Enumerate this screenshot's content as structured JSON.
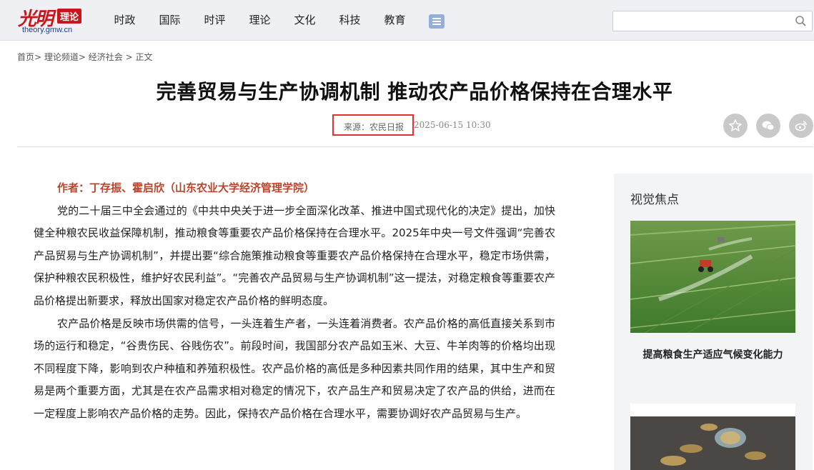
{
  "site": {
    "logo_script": "光明",
    "logo_badge": "理论",
    "logo_url": "theory.gmw.cn"
  },
  "nav": {
    "items": [
      "时政",
      "国际",
      "时评",
      "理论",
      "文化",
      "科技",
      "教育"
    ]
  },
  "search": {
    "placeholder": ""
  },
  "breadcrumb": {
    "home": "首页",
    "sep1": "> ",
    "channel": "理论频道",
    "sep2": "> ",
    "section": "经济社会",
    "sep3": " > ",
    "current": "正文"
  },
  "article": {
    "title": "完善贸易与生产协调机制 推动农产品价格保持在合理水平",
    "source": "来源：农民日报",
    "date": "2025-06-15 10:30",
    "author": "作者：丁存振、霍启欣（山东农业大学经济管理学院）",
    "paragraphs": [
      "党的二十届三中全会通过的《中共中央关于进一步全面深化改革、推进中国式现代化的决定》提出，加快健全种粮农民收益保障机制，推动粮食等重要农产品价格保持在合理水平。2025年中央一号文件强调“完善农产品贸易与生产协调机制”，并提出要“综合施策推动粮食等重要农产品价格保持在合理水平，稳定市场供需，保护种粮农民积极性，维护好农民利益”。“完善农产品贸易与生产协调机制”这一提法，对稳定粮食等重要农产品价格提出新要求，释放出国家对稳定农产品价格的鲜明态度。",
      "农产品价格是反映市场供需的信号，一头连着生产者，一头连着消费者。农产品价格的高低直接关系到市场的运行和稳定，“谷贵伤民、谷贱伤农”。前段时间，我国部分农产品如玉米、大豆、牛羊肉等的价格均出现不同程度下降，影响到农户种植和养殖积极性。农产品价格的高低是多种因素共同作用的结果，其中生产和贸易是两个重要方面，尤其是在农产品需求相对稳定的情况下，农产品生产和贸易决定了农产品的供给，进而在一定程度上影响农产品价格的走势。因此，保持农产品价格在合理水平，需要协调好农产品贸易与生产。"
    ]
  },
  "sidebar": {
    "title": "视觉焦点",
    "items": [
      {
        "caption": "提高粮食生产适应气候变化能力"
      }
    ]
  },
  "colors": {
    "brand_red": "#c8161d",
    "author_color": "#b8452d",
    "highlight_box": "#e03333"
  }
}
